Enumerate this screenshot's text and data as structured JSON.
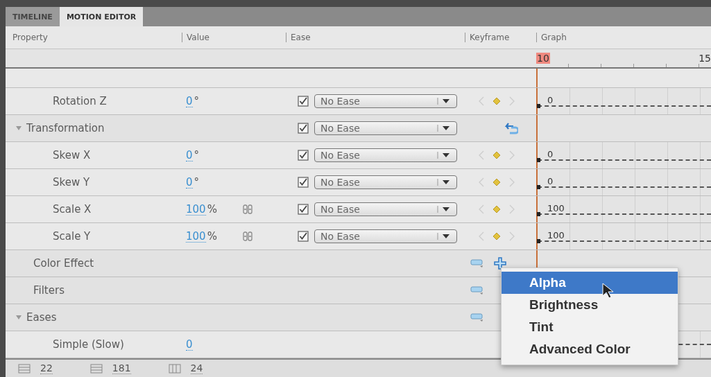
{
  "tabs": [
    {
      "label": "TIMELINE",
      "selected": false
    },
    {
      "label": "MOTION EDITOR",
      "selected": true
    }
  ],
  "columns": [
    "Property",
    "Value",
    "Ease",
    "Keyframe",
    "Graph"
  ],
  "ruler": [
    "10",
    "15"
  ],
  "rows": [
    {
      "kind": "property",
      "name": "Rotation Z",
      "value": "0",
      "unit": "°",
      "linked": false,
      "ease_checked": true,
      "ease": "No Ease",
      "graph_value": "0"
    },
    {
      "kind": "category",
      "name": "Transformation",
      "expanded": true,
      "ease_checked": true,
      "ease": "No Ease",
      "children": [
        {
          "kind": "property",
          "name": "Skew X",
          "value": "0",
          "unit": "°",
          "linked": false,
          "ease_checked": true,
          "ease": "No Ease",
          "graph_value": "0"
        },
        {
          "kind": "property",
          "name": "Skew Y",
          "value": "0",
          "unit": "°",
          "linked": false,
          "ease_checked": true,
          "ease": "No Ease",
          "graph_value": "0"
        },
        {
          "kind": "property",
          "name": "Scale X",
          "value": "100",
          "unit": "%",
          "linked": true,
          "ease_checked": true,
          "ease": "No Ease",
          "graph_value": "100"
        },
        {
          "kind": "property",
          "name": "Scale Y",
          "value": "100",
          "unit": "%",
          "linked": true,
          "ease_checked": true,
          "ease": "No Ease",
          "graph_value": "100"
        }
      ]
    },
    {
      "kind": "group",
      "name": "Color Effect",
      "can_add": true
    },
    {
      "kind": "group",
      "name": "Filters",
      "can_add": false
    },
    {
      "kind": "category",
      "name": "Eases",
      "expanded": true,
      "children": [
        {
          "kind": "ease",
          "name": "Simple (Slow)",
          "value": "0"
        }
      ]
    }
  ],
  "menu": {
    "items": [
      {
        "label": "Alpha",
        "selected": true
      },
      {
        "label": "Brightness",
        "selected": false
      },
      {
        "label": "Tint",
        "selected": false
      },
      {
        "label": "Advanced Color",
        "selected": false
      }
    ]
  },
  "footer": [
    {
      "kind": "rows",
      "value": "22"
    },
    {
      "kind": "rows",
      "value": "181"
    },
    {
      "kind": "columns",
      "value": "24"
    }
  ]
}
